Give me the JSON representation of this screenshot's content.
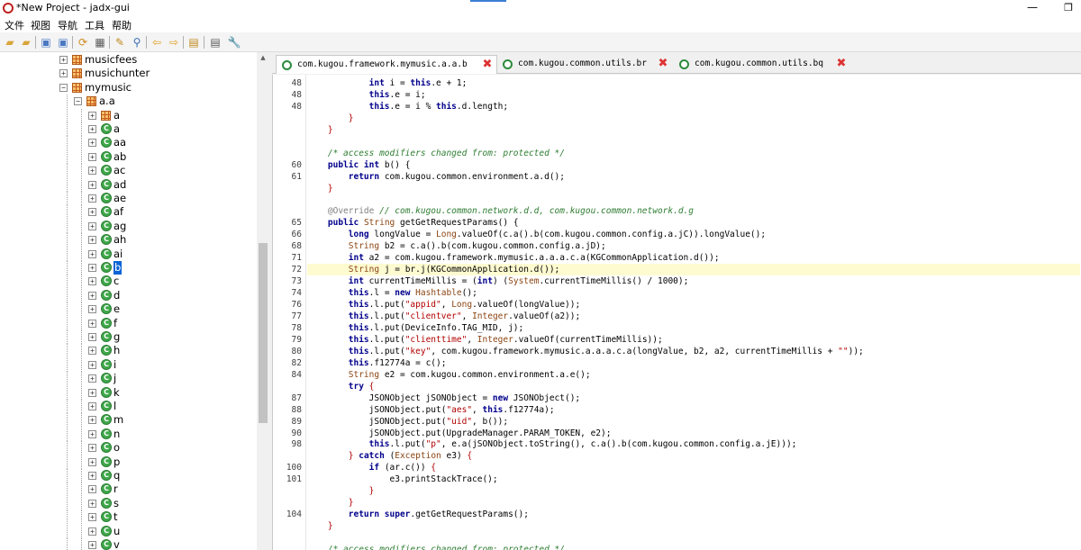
{
  "window": {
    "title": "*New Project - jadx-gui",
    "minimize_glyph": "—",
    "maximize_glyph": "❐"
  },
  "menu": [
    "文件",
    "视图",
    "导航",
    "工具",
    "帮助"
  ],
  "toolbar": {
    "icons": [
      "open-icon",
      "add-files-icon",
      "save-icon",
      "save-all-icon",
      "sync-icon",
      "flatten-packages-icon",
      "search-text-icon",
      "find-class-icon",
      "back-icon",
      "forward-icon",
      "deobfuscation-icon",
      "log-icon",
      "preferences-icon"
    ]
  },
  "tree": {
    "items": [
      {
        "label": "musicfees",
        "kind": "package",
        "expanded": false
      },
      {
        "label": "musichunter",
        "kind": "package",
        "expanded": false
      },
      {
        "label": "mymusic",
        "kind": "package",
        "expanded": true
      },
      {
        "label": "a.a",
        "kind": "package",
        "expanded": true
      },
      {
        "label": "a",
        "kind": "package",
        "expanded": false
      },
      {
        "label": "a",
        "kind": "class",
        "expanded": false
      },
      {
        "label": "aa",
        "kind": "class",
        "expanded": false
      },
      {
        "label": "ab",
        "kind": "class",
        "expanded": false
      },
      {
        "label": "ac",
        "kind": "class",
        "expanded": false
      },
      {
        "label": "ad",
        "kind": "class",
        "expanded": false
      },
      {
        "label": "ae",
        "kind": "class",
        "expanded": false
      },
      {
        "label": "af",
        "kind": "class",
        "expanded": false
      },
      {
        "label": "ag",
        "kind": "class",
        "expanded": false
      },
      {
        "label": "ah",
        "kind": "class",
        "expanded": false
      },
      {
        "label": "ai",
        "kind": "class",
        "expanded": false
      },
      {
        "label": "b",
        "kind": "class",
        "expanded": false,
        "selected": true
      },
      {
        "label": "c",
        "kind": "class",
        "expanded": false
      },
      {
        "label": "d",
        "kind": "class",
        "expanded": false
      },
      {
        "label": "e",
        "kind": "class",
        "expanded": false
      },
      {
        "label": "f",
        "kind": "class",
        "expanded": false
      },
      {
        "label": "g",
        "kind": "class",
        "expanded": false
      },
      {
        "label": "h",
        "kind": "class",
        "expanded": false
      },
      {
        "label": "i",
        "kind": "class",
        "expanded": false
      },
      {
        "label": "j",
        "kind": "class",
        "expanded": false
      },
      {
        "label": "k",
        "kind": "class",
        "expanded": false
      },
      {
        "label": "l",
        "kind": "class",
        "expanded": false
      },
      {
        "label": "m",
        "kind": "class",
        "expanded": false
      },
      {
        "label": "n",
        "kind": "class",
        "expanded": false
      },
      {
        "label": "o",
        "kind": "class",
        "expanded": false
      },
      {
        "label": "p",
        "kind": "class",
        "expanded": false
      },
      {
        "label": "q",
        "kind": "class",
        "expanded": false
      },
      {
        "label": "r",
        "kind": "class",
        "expanded": false
      },
      {
        "label": "s",
        "kind": "class",
        "expanded": false
      },
      {
        "label": "t",
        "kind": "class",
        "expanded": false
      },
      {
        "label": "u",
        "kind": "class",
        "expanded": false
      },
      {
        "label": "v",
        "kind": "class",
        "expanded": false
      }
    ]
  },
  "tabs": [
    {
      "label": "com.kugou.framework.mymusic.a.a.b",
      "active": true
    },
    {
      "label": "com.kugou.common.utils.br",
      "active": false
    },
    {
      "label": "com.kugou.common.utils.bq",
      "active": false
    }
  ],
  "code": {
    "highlighted_line": 16,
    "lines": [
      {
        "ln": "48",
        "tokens": [
          [
            "",
            "            "
          ],
          [
            "kw",
            "int"
          ],
          [
            "",
            " i = "
          ],
          [
            "kw",
            "this"
          ],
          [
            "",
            ".e + 1;"
          ]
        ]
      },
      {
        "ln": "48",
        "tokens": [
          [
            "",
            "            "
          ],
          [
            "kw",
            "this"
          ],
          [
            "",
            ".e = i;"
          ]
        ]
      },
      {
        "ln": "48",
        "tokens": [
          [
            "",
            "            "
          ],
          [
            "kw",
            "this"
          ],
          [
            "",
            ".e = i % "
          ],
          [
            "kw",
            "this"
          ],
          [
            "",
            ".d.length;"
          ]
        ]
      },
      {
        "ln": "",
        "tokens": [
          [
            "",
            "        "
          ],
          [
            "st",
            "}"
          ]
        ]
      },
      {
        "ln": "",
        "tokens": [
          [
            "",
            "    "
          ],
          [
            "st",
            "}"
          ]
        ]
      },
      {
        "ln": "",
        "tokens": [
          [
            "",
            ""
          ]
        ]
      },
      {
        "ln": "",
        "tokens": [
          [
            "",
            "    "
          ],
          [
            "cm",
            "/* access modifiers changed from: protected */"
          ]
        ]
      },
      {
        "ln": "60",
        "tokens": [
          [
            "",
            "    "
          ],
          [
            "kw",
            "public int"
          ],
          [
            "",
            " b() {"
          ]
        ]
      },
      {
        "ln": "61",
        "tokens": [
          [
            "",
            "        "
          ],
          [
            "kw",
            "return"
          ],
          [
            "",
            " com.kugou.common.environment.a.d();"
          ]
        ]
      },
      {
        "ln": "",
        "tokens": [
          [
            "",
            "    "
          ],
          [
            "st",
            "}"
          ]
        ]
      },
      {
        "ln": "",
        "tokens": [
          [
            "",
            ""
          ]
        ]
      },
      {
        "ln": "",
        "tokens": [
          [
            "",
            "    "
          ],
          [
            "an",
            "@Override"
          ],
          [
            "cm",
            " // com.kugou.common.network.d.d, com.kugou.common.network.d.g"
          ]
        ]
      },
      {
        "ln": "65",
        "tokens": [
          [
            "",
            "    "
          ],
          [
            "kw",
            "public"
          ],
          [
            "",
            " "
          ],
          [
            "ty",
            "String"
          ],
          [
            "",
            " getGetRequestParams() {"
          ]
        ]
      },
      {
        "ln": "66",
        "tokens": [
          [
            "",
            "        "
          ],
          [
            "kw",
            "long"
          ],
          [
            "",
            " longValue = "
          ],
          [
            "ty",
            "Long"
          ],
          [
            "",
            ".valueOf(c.a().b(com.kugou.common.config.a.jC)).longValue();"
          ]
        ]
      },
      {
        "ln": "68",
        "tokens": [
          [
            "",
            "        "
          ],
          [
            "ty",
            "String"
          ],
          [
            "",
            " b2 = c.a().b(com.kugou.common.config.a.jD);"
          ]
        ]
      },
      {
        "ln": "71",
        "tokens": [
          [
            "",
            "        "
          ],
          [
            "kw",
            "int"
          ],
          [
            "",
            " a2 = com.kugou.framework.mymusic.a.a.a.c.a(KGCommonApplication.d());"
          ]
        ]
      },
      {
        "ln": "72",
        "tokens": [
          [
            "",
            "        "
          ],
          [
            "ty",
            "String"
          ],
          [
            "",
            " j = br.j(KGCommonApplication.d());"
          ]
        ]
      },
      {
        "ln": "73",
        "tokens": [
          [
            "",
            "        "
          ],
          [
            "kw",
            "int"
          ],
          [
            "",
            " currentTimeMillis = ("
          ],
          [
            "kw",
            "int"
          ],
          [
            "",
            ") ("
          ],
          [
            "ty",
            "System"
          ],
          [
            "",
            ".currentTimeMillis() / 1000);"
          ]
        ]
      },
      {
        "ln": "74",
        "tokens": [
          [
            "",
            "        "
          ],
          [
            "kw",
            "this"
          ],
          [
            "",
            ".l = "
          ],
          [
            "kw",
            "new"
          ],
          [
            "",
            " "
          ],
          [
            "ty",
            "Hashtable"
          ],
          [
            "",
            "();"
          ]
        ]
      },
      {
        "ln": "76",
        "tokens": [
          [
            "",
            "        "
          ],
          [
            "kw",
            "this"
          ],
          [
            "",
            ".l.put("
          ],
          [
            "st",
            "\"appid\""
          ],
          [
            "",
            ", "
          ],
          [
            "ty",
            "Long"
          ],
          [
            "",
            ".valueOf(longValue));"
          ]
        ]
      },
      {
        "ln": "77",
        "tokens": [
          [
            "",
            "        "
          ],
          [
            "kw",
            "this"
          ],
          [
            "",
            ".l.put("
          ],
          [
            "st",
            "\"clientver\""
          ],
          [
            "",
            ", "
          ],
          [
            "ty",
            "Integer"
          ],
          [
            "",
            ".valueOf(a2));"
          ]
        ]
      },
      {
        "ln": "78",
        "tokens": [
          [
            "",
            "        "
          ],
          [
            "kw",
            "this"
          ],
          [
            "",
            ".l.put(DeviceInfo.TAG_MID, j);"
          ]
        ]
      },
      {
        "ln": "79",
        "tokens": [
          [
            "",
            "        "
          ],
          [
            "kw",
            "this"
          ],
          [
            "",
            ".l.put("
          ],
          [
            "st",
            "\"clienttime\""
          ],
          [
            "",
            ", "
          ],
          [
            "ty",
            "Integer"
          ],
          [
            "",
            ".valueOf(currentTimeMillis));"
          ]
        ]
      },
      {
        "ln": "80",
        "tokens": [
          [
            "",
            "        "
          ],
          [
            "kw",
            "this"
          ],
          [
            "",
            ".l.put("
          ],
          [
            "st",
            "\"key\""
          ],
          [
            "",
            ", com.kugou.framework.mymusic.a.a.a.c.a(longValue, b2, a2, currentTimeMillis + "
          ],
          [
            "st",
            "\"\""
          ],
          [
            "",
            "));"
          ]
        ]
      },
      {
        "ln": "82",
        "tokens": [
          [
            "",
            "        "
          ],
          [
            "kw",
            "this"
          ],
          [
            "",
            ".f12774a = c();"
          ]
        ]
      },
      {
        "ln": "84",
        "tokens": [
          [
            "",
            "        "
          ],
          [
            "ty",
            "String"
          ],
          [
            "",
            " e2 = com.kugou.common.environment.a.e();"
          ]
        ]
      },
      {
        "ln": "",
        "tokens": [
          [
            "",
            "        "
          ],
          [
            "kw",
            "try"
          ],
          [
            "",
            " "
          ],
          [
            "st",
            "{"
          ]
        ]
      },
      {
        "ln": "87",
        "tokens": [
          [
            "",
            "            JSONObject jSONObject = "
          ],
          [
            "kw",
            "new"
          ],
          [
            "",
            " JSONObject();"
          ]
        ]
      },
      {
        "ln": "88",
        "tokens": [
          [
            "",
            "            jSONObject.put("
          ],
          [
            "st",
            "\"aes\""
          ],
          [
            "",
            ", "
          ],
          [
            "kw",
            "this"
          ],
          [
            "",
            ".f12774a);"
          ]
        ]
      },
      {
        "ln": "89",
        "tokens": [
          [
            "",
            "            jSONObject.put("
          ],
          [
            "st",
            "\"uid\""
          ],
          [
            "",
            ", b());"
          ]
        ]
      },
      {
        "ln": "90",
        "tokens": [
          [
            "",
            "            jSONObject.put(UpgradeManager.PARAM_TOKEN, e2);"
          ]
        ]
      },
      {
        "ln": "98",
        "tokens": [
          [
            "",
            "            "
          ],
          [
            "kw",
            "this"
          ],
          [
            "",
            ".l.put("
          ],
          [
            "st",
            "\"p\""
          ],
          [
            "",
            ", e.a(jSONObject.toString(), c.a().b(com.kugou.common.config.a.jE)));"
          ]
        ]
      },
      {
        "ln": "",
        "tokens": [
          [
            "",
            "        "
          ],
          [
            "st",
            "}"
          ],
          [
            "",
            " "
          ],
          [
            "kw",
            "catch"
          ],
          [
            "",
            " ("
          ],
          [
            "ty",
            "Exception"
          ],
          [
            "",
            " e3) "
          ],
          [
            "st",
            "{"
          ]
        ]
      },
      {
        "ln": "100",
        "tokens": [
          [
            "",
            "            "
          ],
          [
            "kw",
            "if"
          ],
          [
            "",
            " (ar.c()) "
          ],
          [
            "st",
            "{"
          ]
        ]
      },
      {
        "ln": "101",
        "tokens": [
          [
            "",
            "                e3.printStackTrace();"
          ]
        ]
      },
      {
        "ln": "",
        "tokens": [
          [
            "",
            "            "
          ],
          [
            "st",
            "}"
          ]
        ]
      },
      {
        "ln": "",
        "tokens": [
          [
            "",
            "        "
          ],
          [
            "st",
            "}"
          ]
        ]
      },
      {
        "ln": "104",
        "tokens": [
          [
            "",
            "        "
          ],
          [
            "kw",
            "return super"
          ],
          [
            "",
            ".getGetRequestParams();"
          ]
        ]
      },
      {
        "ln": "",
        "tokens": [
          [
            "",
            "    "
          ],
          [
            "st",
            "}"
          ]
        ]
      },
      {
        "ln": "",
        "tokens": [
          [
            "",
            ""
          ]
        ]
      },
      {
        "ln": "",
        "tokens": [
          [
            "",
            "    "
          ],
          [
            "cm",
            "/* access modifiers changed from: protected */"
          ]
        ]
      }
    ]
  }
}
